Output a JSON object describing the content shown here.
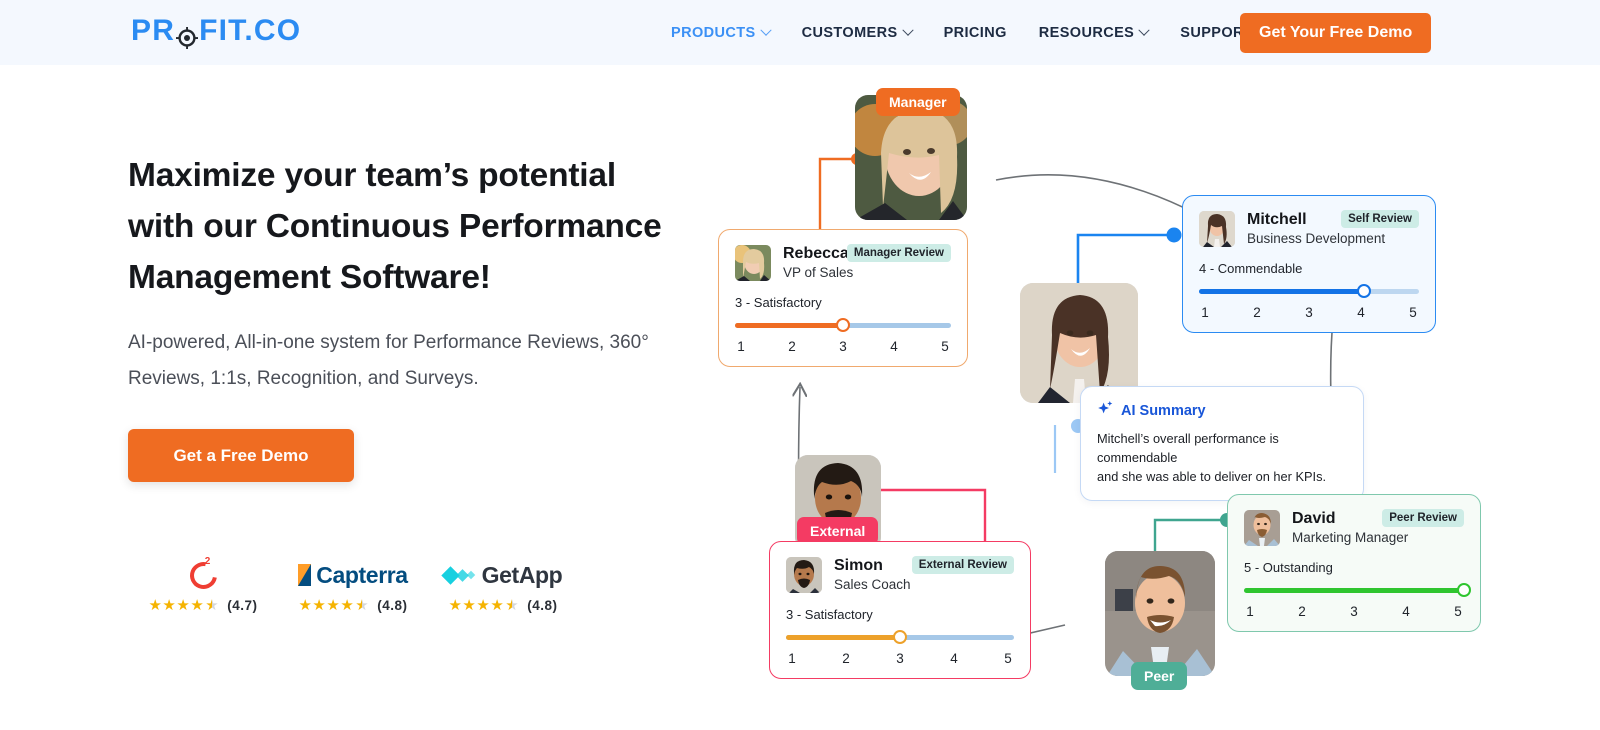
{
  "header": {
    "logo": {
      "pre": "PR",
      "icon": "target-icon",
      "post": "FIT.CO"
    },
    "nav": [
      {
        "label": "PRODUCTS",
        "has_caret": true,
        "active": true
      },
      {
        "label": "CUSTOMERS",
        "has_caret": true,
        "active": false
      },
      {
        "label": "PRICING",
        "has_caret": false,
        "active": false
      },
      {
        "label": "RESOURCES",
        "has_caret": true,
        "active": false
      },
      {
        "label": "SUPPORT",
        "has_caret": true,
        "active": false
      }
    ],
    "cta_label": "Get Your Free Demo",
    "cta_color": "#ef6c22",
    "background": "#f4f8fe"
  },
  "hero": {
    "heading_line1": "Maximize your team’s potential",
    "heading_line2": "with our Continuous Performance",
    "heading_line3": "Management Software!",
    "subheading": "AI-powered, All-in-one system for Performance Reviews, 360° Reviews, 1:1s, Recognition, and Surveys.",
    "cta_label": "Get a Free Demo"
  },
  "badges": [
    {
      "name": "G2",
      "logo": "g2-logo",
      "stars": "★★★★",
      "half_star": "★",
      "score": "(4.7)"
    },
    {
      "name": "Capterra",
      "logo": "capterra-logo",
      "stars": "★★★★",
      "half_star": "★",
      "score": "(4.8)"
    },
    {
      "name": "GetApp",
      "logo": "getapp-logo",
      "stars": "★★★★",
      "half_star": "★",
      "score": "(4.8)"
    }
  ],
  "diagram": {
    "role_badges": [
      {
        "label": "Manager",
        "color": "#ef6c22"
      },
      {
        "label": "External",
        "color": "#f43b63"
      },
      {
        "label": "Peer",
        "color": "#4fae97"
      }
    ],
    "cards": [
      {
        "id": "rebecca",
        "name": "Rebecca",
        "role": "VP of Sales",
        "review_tag": "Manager Review",
        "rating_label": "3 - Satisfactory",
        "rating_value": 3,
        "scale": [
          "1",
          "2",
          "3",
          "4",
          "5"
        ],
        "accent": "#ef6c22",
        "border": "#f0a96e",
        "background": "#ffffff"
      },
      {
        "id": "mitchell",
        "name": "Mitchell",
        "role": "Business Development",
        "review_tag": "Self Review",
        "rating_label": "4 - Commendable",
        "rating_value": 4,
        "scale": [
          "1",
          "2",
          "3",
          "4",
          "5"
        ],
        "accent": "#1373e6",
        "border": "#2b8bf2",
        "background": "#f3f9ff"
      },
      {
        "id": "simon",
        "name": "Simon",
        "role": "Sales Coach",
        "review_tag": "External Review",
        "rating_label": "3 - Satisfactory",
        "rating_value": 3,
        "scale": [
          "1",
          "2",
          "3",
          "4",
          "5"
        ],
        "accent": "#eda12a",
        "border": "#f43b63",
        "background": "#ffffff"
      },
      {
        "id": "david",
        "name": "David",
        "role": "Marketing Manager",
        "review_tag": "Peer Review",
        "rating_label": "5 - Outstanding",
        "rating_value": 5,
        "scale": [
          "1",
          "2",
          "3",
          "4",
          "5"
        ],
        "accent": "#2fc52f",
        "border": "#7fc8ad",
        "background": "#f6fbf7"
      }
    ],
    "ai_summary": {
      "icon": "sparkle-icon",
      "title": "AI Summary",
      "line1": "Mitchell’s overall performance is commendable",
      "line2": "and she was able to deliver on her KPIs."
    }
  }
}
